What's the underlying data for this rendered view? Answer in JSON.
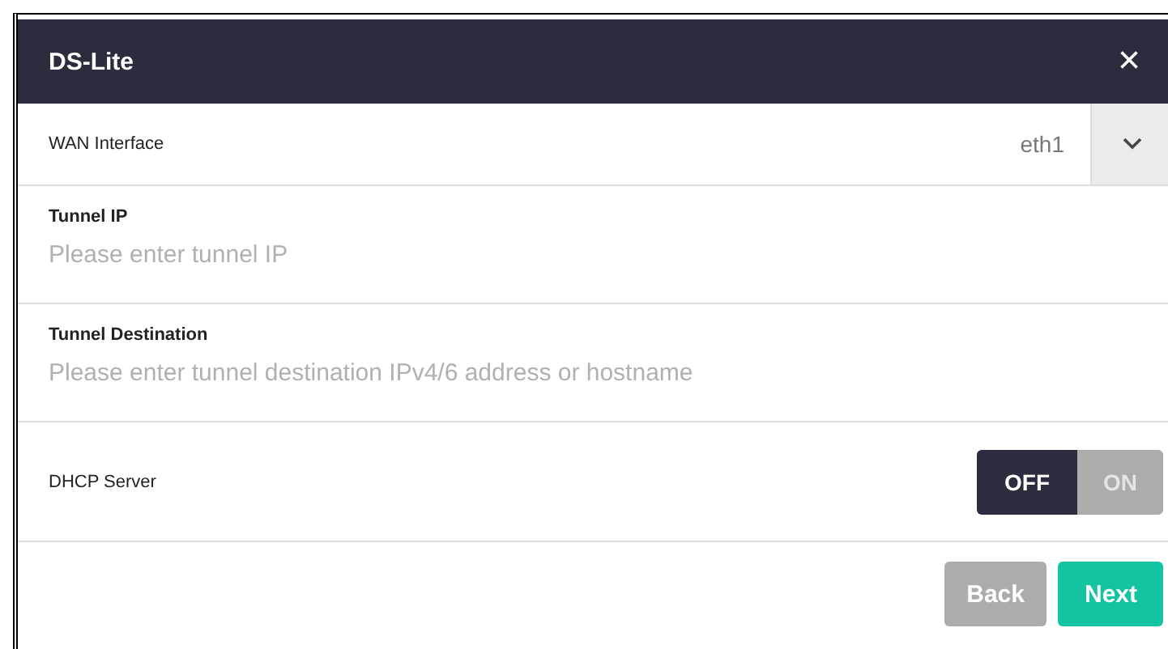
{
  "dialog": {
    "title": "DS-Lite",
    "close": "×"
  },
  "wan_interface": {
    "label": "WAN Interface",
    "value": "eth1"
  },
  "fields": [
    {
      "label": "Tunnel IP",
      "placeholder": "Please enter tunnel IP"
    },
    {
      "label": "Tunnel Destination",
      "placeholder": "Please enter tunnel destination IPv4/6 address or hostname"
    }
  ],
  "dhcp_server": {
    "label": "DHCP Server",
    "options": [
      {
        "label": "OFF",
        "selected": true
      },
      {
        "label": "ON",
        "selected": false
      }
    ]
  },
  "buttons": [
    {
      "label": "Back",
      "kind": "secondary"
    },
    {
      "label": "Next",
      "kind": "primary"
    }
  ]
}
